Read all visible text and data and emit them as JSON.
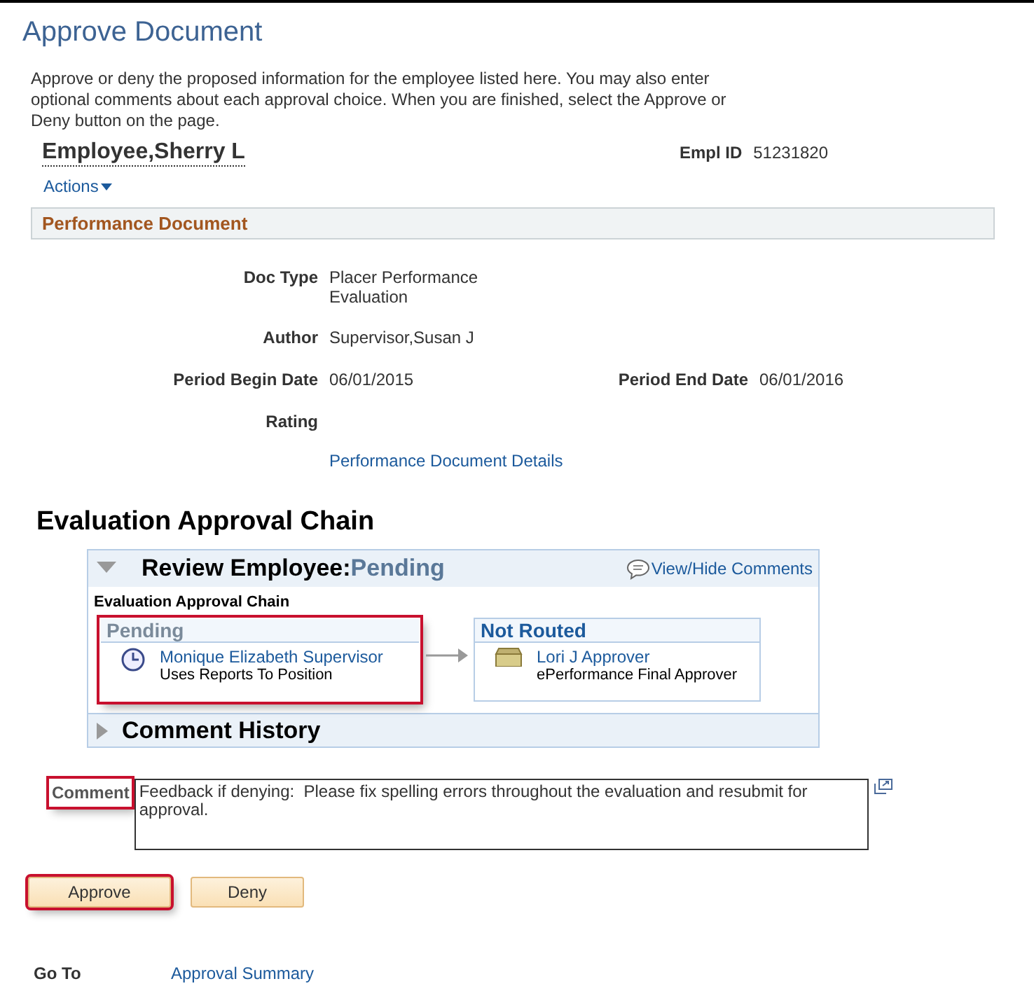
{
  "title": "Approve Document",
  "instructions": "Approve or deny the proposed information for the employee listed here. You may also enter optional comments about each approval choice. When you are finished, select the Approve or Deny button on the page.",
  "employee": {
    "name": "Employee,Sherry L",
    "id_label": "Empl ID",
    "id": "51231820"
  },
  "actions": {
    "label": "Actions"
  },
  "section": {
    "title": "Performance Document"
  },
  "fields": [
    {
      "label": "Doc Type",
      "value": "Placer Performance Evaluation"
    },
    {
      "label": "Author",
      "value": "Supervisor,Susan J"
    },
    {
      "label": "Period Begin Date",
      "value": "06/01/2015",
      "label_2": "Period End Date",
      "value_2": "06/01/2016"
    },
    {
      "label": "Rating"
    }
  ],
  "details_link": "Performance Document Details",
  "chain_heading": "Evaluation Approval Chain",
  "review": {
    "expanded": true,
    "title": "Review Employee:",
    "status": "Pending",
    "comments_link": "View/Hide Comments",
    "subtitle": "Evaluation Approval Chain",
    "steps": [
      {
        "status": "Pending",
        "kind": "pending",
        "name": "Monique Elizabeth Supervisor",
        "role": "Uses Reports To Position",
        "highlighted": true
      },
      {
        "status": "Not Routed",
        "kind": "not_routed",
        "name": "Lori J Approver",
        "role": "ePerformance Final Approver",
        "highlighted": false
      }
    ]
  },
  "comment_history": {
    "title": "Comment History",
    "expanded": false
  },
  "comment": {
    "label": "Comment",
    "value": "Feedback if denying:  Please fix spelling errors throughout the evaluation and resubmit for approval.",
    "highlighted": true
  },
  "buttons": [
    {
      "label": "Approve",
      "highlighted": true
    },
    {
      "label": "Deny",
      "highlighted": false
    }
  ],
  "goto": {
    "label": "Go To",
    "link": "Approval Summary"
  }
}
